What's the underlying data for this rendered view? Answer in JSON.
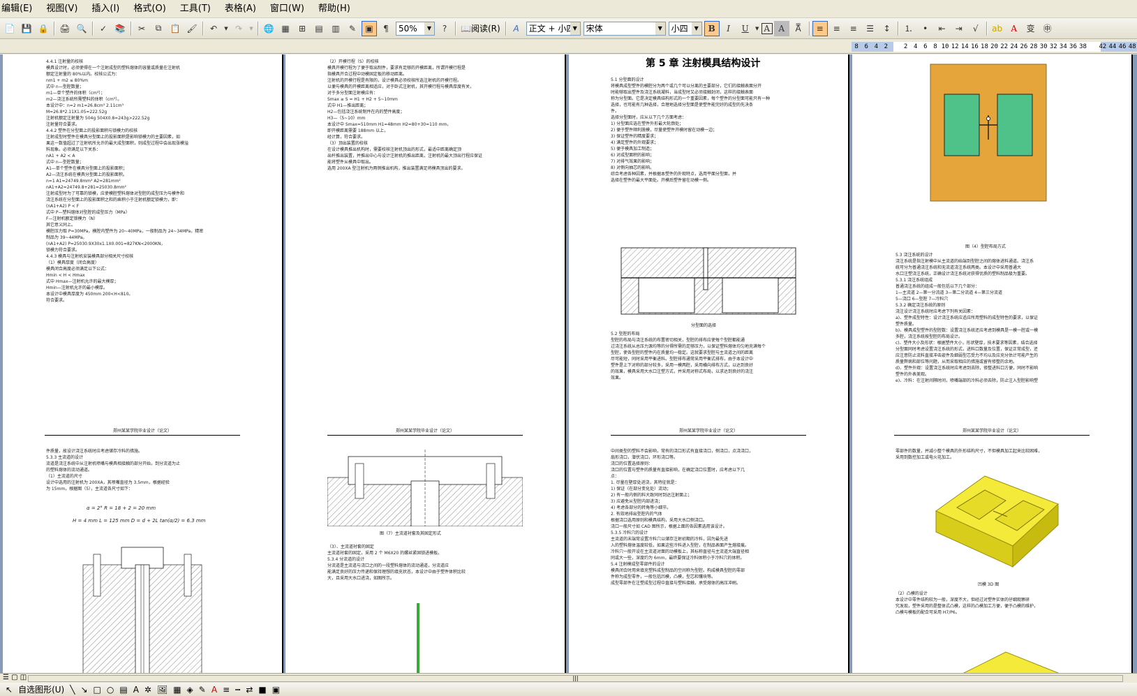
{
  "menu": [
    "编辑(E)",
    "视图(V)",
    "插入(I)",
    "格式(O)",
    "工具(T)",
    "表格(A)",
    "窗口(W)",
    "帮助(H)"
  ],
  "toolbar": {
    "zoom": "50%",
    "read_label": "阅读(R)",
    "style": "正文 + 小四",
    "font": "宋体",
    "size": "小四"
  },
  "ruler_numbers": [
    "8",
    "6",
    "4",
    "2",
    "",
    "2",
    "4",
    "6",
    "8",
    "10",
    "12",
    "14",
    "16",
    "18",
    "20",
    "22",
    "24",
    "26",
    "28",
    "30",
    "32",
    "34",
    "36",
    "38",
    "",
    "42",
    "44",
    "46",
    "48"
  ],
  "pages": {
    "p13": {
      "paragraphs": [
        "4.4.1 注射量的校核",
        "模具设计时，必须使得在一个注射成型的塑料熔体的容量或质量在注射机",
        "额定注射量的 80%以内。校核公式为：",
        "nm1 + m2 ≤ 80%m",
        "式中 n—型腔数量；",
        "m1—单个塑件的体积（cm³）；",
        "m2—浇注系统所需塑料的体积（cm³）。",
        "本设计中：n=2 m1=26.8cm³ 2.11cm³",
        "M=26.8*2.11X1.05=222.52g",
        "注射机额定注射量为 504g 504X0.8=243g>222.52g",
        "注射量符合要求。",
        "4.4.2 塑件在分型面上的投影面积与锁模力的校核",
        "注射成型时塑件在模具分型面上的投影面积是影响锁模力的主要因素，如",
        "果这一数值超过了注射机所允许的最大成型面积，则成型过程中会出现涨模溢",
        "料现象。必须满足以下关系：",
        "nA1 + A2 < A",
        "式中 n—型腔数量；",
        "A1—单个塑件在模具分型面上的投影面积；",
        "A2—浇注系统在模具分型面上的投影面积。",
        "n=1 A1=24749.8mm²  A2=281mm²",
        "nA1+A2=24749.8+281=25030.8mm²",
        "注射成型时为了可靠的锁模，应使模腔塑料熔体对型腔的成型压力与模件和",
        "浇注系统在分型面上的投影面积之和的乘积小于注射机额定锁模力，即：",
        "(nA1+A2) P < F",
        "式中 P—塑料熔体对型腔的成型压力（MPa）",
        "F—注射机额定锁模力（N）",
        "其它意义同上。",
        "模腔压力取 P=30MPa，模腔内塑件为 20~40MPa，一般制品为 24~34MPa，精密",
        "制品为 39~44MPa。",
        "(nA1+A2) P=25030.9X30x1.1X0.001=827KN<2000KN，",
        "锁模力符合要求。",
        "4.4.3 模具与注射机安装模具部分相关尺寸校核",
        "（1）模具厚度（闭合高度）",
        "模具闭合高度必须满足以下公式：",
        "Hmin < H < Hmax",
        "式中 Hmax—注射机允许的最大模厚；",
        "Hmin—注射机允许的最小模厚。",
        "本设计中模具厚度为 450mm 200<H<810。",
        "符合要求。"
      ],
      "pnum": "13"
    },
    "p14": {
      "paragraphs": [
        "（2）开模行程（S）的校核",
        "模具开模行程为了便于取出制件，要求有足够的开模距离，所谓开模行程是",
        "指模具开合过程中动模固定板的移动距离。",
        "注射机的开模行程是有限的，设计模具必须校核所选注射机的开模行程。",
        "以便与模具的开模距离相适应，对于卧式注射机，其开模行程与模具厚度有关，",
        "对于多分型面注射模应有：",
        "Smax ≥ S = H1 + H2 + 5~10mm",
        "式中 H1—推出距离；",
        "H2—包括浇注系统制件在内的塑件高度；",
        "H3—（5~10）mm",
        "本设计中 Smax=510mm H1=48mm H2=80+30=110 mm，",
        "即开模距离需要 188mm 以上，",
        "经计算，符合要求。",
        "（3）顶出装置的校核",
        "在设计模具推出机构时，需要校核注射机顶出的形式，最适中距离确定顶",
        "出杆推出装置，并推出中心与设计注射机的推出距离，注射机的最大顶出行程应保证",
        "能将塑件从模具中取出。",
        "选用 200XA 型注射机为两侧推出机构，推出装置满足将模具顶出的要求。"
      ],
      "pnum": "14"
    },
    "p15": {
      "chapter": "第 5 章  注射模具结构设计",
      "paragraphs": [
        "5.1 分型面的设计",
        "将模具成型塑件的模腔分为两个或几个可以分离的主要部分，它们的接触表面分开",
        "时能够取出塑件及浇注系统凝料，当成型时又必须接触封闭，这样的接触表面",
        "称为分型面。它是决定模具结构形式的一个重要因素，每个塑件的分型面可能只有一种",
        "选择，也可能有几种选择，合理地选择分型面是使塑件能完好的成型的先决条",
        "件。",
        "选择分型面时，应从以下几个方面考虑：",
        "1) 分型面应选在塑件外形最大轮廓处；",
        "2) 便于塑件顺利脱模，尽量使塑件开模时留在动模一边；",
        "3) 保证塑件的精度要求；",
        "4) 满足塑件的外观要求；",
        "5) 便于模具加工制造；",
        "6) 对成型面积的影响；",
        "7) 对排气效果的影响；",
        "8) 对侧向抽芯的影响。",
        "综合考虑各种因素，并根据本塑件的外观特点，选用平面分型面，并",
        "选择在塑件的最大平面处。开模后塑件留在动模一侧。"
      ],
      "fig_caption": "分型面的选择",
      "section2": [
        "5.2 型腔的布局",
        "型腔的布局与浇注系统的布置密切相关，型腔的排布应使每个型腔都能通",
        "过浇注系统从总压力源均等的分得所需的足够压力，以保证塑料熔体均匀地充满每个",
        "型腔，使各型腔的塑件内在质量均一稳定。这就要求型腔与主流道之间的距离",
        "尽可能短，同时采用平衡进料。型腔排布通常采用平衡式排布，由于本设计中",
        "塑件是上下对称的部分较多，采用一模两腔，采用横向排布方式，以达到良好",
        "的效果，模具采用大水口注塑方式，并采用对称式布局，以求达到良好的浇注",
        "效果。"
      ],
      "pnum": "15"
    },
    "p16": {
      "fig_caption": "图（4）型腔布局方式",
      "paragraphs": [
        "5.3 浇注系统的设计",
        "浇注系统是指注射模中从主流道的始端到型腔之间的熔体进料通道。浇注系",
        "统可分为普通浇注系统和无流道浇注系统两类。本设计中采用普通大",
        "水口注塑浇注系统，正确设计浇注系统对获得优质的塑料制品极为重要。",
        "5.3.1 浇注系统组成",
        "普通浇注系统的组成一般包括以下几个部分：",
        "1—主流道 2—第一分流道 3—第二分流道 4—第三分流道",
        "5—浇口 6—型腔 7—冷料穴",
        "5.3.2 确定浇注系统的原则",
        "浇注设计浇注系统时应考虑下列有关因素：",
        "a)、塑件成型特性：设计浇注系统应适应所用塑料的成型特性的要求，以保证",
        "塑件质量。",
        "b)、模具成型塑件的型腔数：设置浇注系统还应考虑到模具是一模一腔或一模",
        "多腔，浇注系统按型腔的布局设计。",
        "c)、塑件大小及形状：根据塑件大小，形状壁厚，技术要求等因素，结合选择",
        "分型面同时考虑设置浇注系统的形式，进料口数量及位置，保证正常成型，还",
        "应注意防止流料直接冲击嵌件及细弱型芯受力不均以及应充分估计可能产生的",
        "质量弊病和部位等问题，从而采取相应的措施或留有修整的余地。",
        "d)、塑件外观：设置浇注系统时应考虑到去除，修整进料口方便，同时不影响",
        "塑件的外表美观。",
        "e)、冷料：在注射间隔时间，喷嘴端部的冷料必须去除，防止注入型腔影响塑"
      ],
      "pnum": "16"
    },
    "p17": {
      "header": "郑州某某学院毕业设计（论文）",
      "paragraphs": [
        "件质量，故设计浇注系统时应考虑储存冷料的措施。",
        "5.3.3 主流道的设计",
        "流道是浇注系统中从注射机喷嘴与模具相接触的部分开始，到分流道为止",
        "的塑料熔体的流动通道。",
        "（1）主流道的尺寸",
        "设计中选用的注射机为 200XA，其喷嘴直径为 3.5mm，根据经验",
        "为 15mm，根据图（5），主流道各尺寸如下："
      ],
      "formula1": "α = 2°    R = 18 + 2 = 20 mm",
      "formula2": "H = 4 mm    L = 125 mm    D = d + 2L tan(α/2) = 6.3 mm"
    },
    "p18": {
      "header": "郑州某某学院毕业设计（论文）",
      "fig_caption": "图（7）主流道衬套及其固定形式",
      "paragraphs": [
        "（3）、主流道衬套的固定",
        "主流道衬套的固定，采用 2 个 M6X20 的螺丝紧固锁进模板。",
        "5.3.4 分流道的设计",
        "分流道是主流道与浇口之间的一段塑料熔体的流动通道，分流道应",
        "能满足良好的压力传递和保持理想的填充状态，本设计中由于塑件体积比较",
        "大，且采用大水口进浇，如图所示。"
      ]
    },
    "p19": {
      "header": "郑州某某学院毕业设计（论文）",
      "paragraphs": [
        "中间类型的塑料不会影响，常有的浇口形式有直接浇口，侧浇口，点浇浇口，",
        "扇形浇口，潜伏浇口，环形浇口等。",
        "浇口的位置选择原则：",
        "浇口的位置与塑件的质量有直接影响，在确定浇口位置时，应考虑以下几",
        "点：",
        "1. 尽量在壁厚处进浇，其特征就是：",
        "1) 保证（在部分变化处）流动；",
        "2) 有一般内侧的料大致同时到达注射面上；",
        "3) 应避免从型腔内部进浇；",
        "4) 考虑各部分的转角等小细节。",
        "2. 有效地排出型腔内的气体",
        "根据浇口选用原则和模具结构，采用大水口侧浇口。",
        "浇口一般尺寸如 CAD 图所示，根据上面的各因素选用该设计。",
        "5.3.5 冷料穴的设计",
        "主流道的末端常设置冷料穴以储存注射初期的冷料，因为最先进",
        "入的塑料熔体温度较低，如果这些冷料进入型腔，在制品表面产生熔接痕。",
        "冷料穴一般开设在主流道对面的动模板上，其标称直径与主流道大端直径相",
        "同或大一些，深度约为 6mm，最终要保证冷料体积小于冷料穴的体积。",
        "5.4 注射模成型零部件的设计",
        "模具闭合时用来填充塑料成型制品的空间称为型腔。构成模具型腔的零部",
        "件称为成型零件，一般包括凹模，凸模，型芯和镶块等。",
        "成型零部件在注塑成型过程中直接与塑料接触，承受熔体的高压冲刷。"
      ]
    },
    "p20": {
      "header": "郑州某某学院毕业设计（论文）",
      "paragraphs": [
        "零部件的数量，并减小整个模具的外形结构尺寸，不但模具加工起来比较困难，",
        "采用到数控加工或电火花加工。"
      ],
      "fig_caption": "凹模 3D 图",
      "paragraphs2": [
        "（2）凸模的设计",
        "本设计中零件结构较为一般，深度不大，但经过对塑件实体的仔细观察研",
        "究发现，塑件采用的是整体式凸模，这样的凸模加工方便，便于凸模的维护，",
        "凸模与模板的配合可采用 H7/P6。"
      ]
    }
  },
  "ime": [
    "中",
    "简"
  ],
  "drawbar": {
    "autoshapes": "自选图形(U)"
  }
}
